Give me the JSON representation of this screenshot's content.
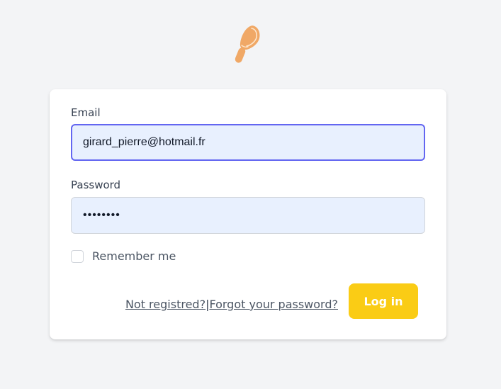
{
  "logo": {
    "icon": "popsicle-icon",
    "color": "#f0a866"
  },
  "form": {
    "email_label": "Email",
    "email_value": "girard_pierre@hotmail.fr",
    "password_label": "Password",
    "password_value": "••••••••",
    "remember_label": "Remember me",
    "remember_checked": false,
    "not_registered_link": "Not registred?",
    "separator": "|",
    "forgot_password_link": "Forgot your password?",
    "login_button": "Log in"
  },
  "colors": {
    "background": "#f3f4f6",
    "accent_button": "#facc15",
    "focus_border": "#6366f1",
    "autofill_bg": "#e8f0fe"
  }
}
